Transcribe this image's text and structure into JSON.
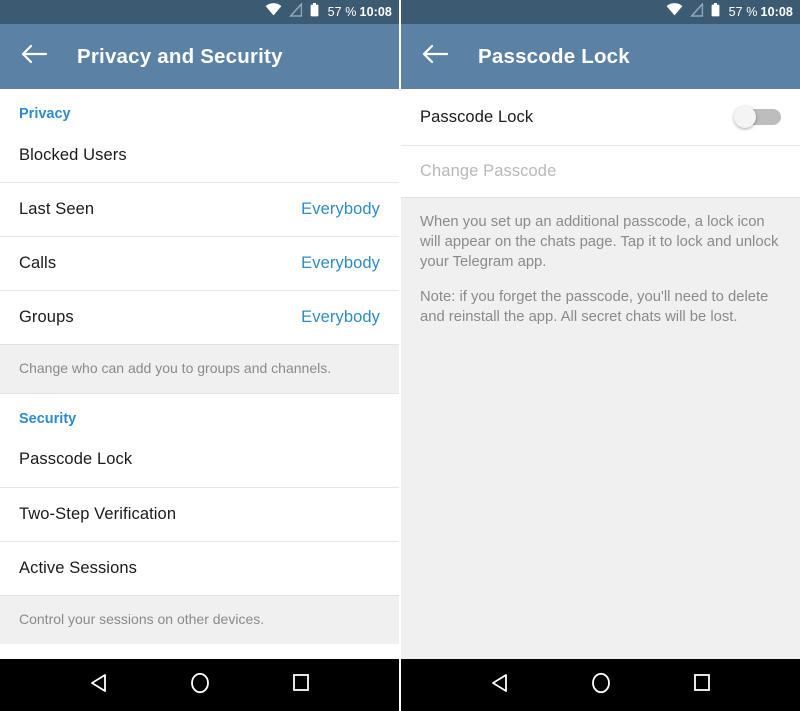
{
  "status_bar": {
    "icons": [
      "wifi-icon",
      "signal-off-icon",
      "battery-icon"
    ],
    "battery_percent": "57 %",
    "clock": "10:08"
  },
  "colors": {
    "status_bar_bg": "#3d5a73",
    "app_bar_bg": "#5b82a5",
    "accent": "#2e8bc9",
    "hint_bg": "#f0f0f0",
    "nav_bar_bg": "#000000"
  },
  "left_panel": {
    "app_bar": {
      "back_icon": "arrow-left-icon",
      "title": "Privacy and Security"
    },
    "sections": [
      {
        "header": "Privacy",
        "rows": [
          {
            "label": "Blocked Users",
            "value": ""
          },
          {
            "label": "Last Seen",
            "value": "Everybody"
          },
          {
            "label": "Calls",
            "value": "Everybody"
          },
          {
            "label": "Groups",
            "value": "Everybody"
          }
        ],
        "hint": "Change who can add you to groups and channels."
      },
      {
        "header": "Security",
        "rows": [
          {
            "label": "Passcode Lock",
            "value": ""
          },
          {
            "label": "Two-Step Verification",
            "value": ""
          },
          {
            "label": "Active Sessions",
            "value": ""
          }
        ],
        "hint": "Control your sessions on other devices."
      }
    ]
  },
  "right_panel": {
    "app_bar": {
      "back_icon": "arrow-left-icon",
      "title": "Passcode Lock"
    },
    "toggle_row": {
      "label": "Passcode Lock",
      "toggle_name": "passcode-lock-toggle",
      "toggle_state": "off"
    },
    "change_passcode_row": {
      "label": "Change Passcode",
      "enabled": "false"
    },
    "info": {
      "paragraph_1": "When you set up an additional passcode, a lock icon will appear on the chats page. Tap it to lock and unlock your Telegram app.",
      "paragraph_2": "Note: if you forget the passcode, you'll need to delete and reinstall the app. All secret chats will be lost."
    }
  },
  "nav_bar": {
    "buttons": [
      {
        "name": "back-nav-button",
        "icon": "triangle-back-icon"
      },
      {
        "name": "home-nav-button",
        "icon": "circle-home-icon"
      },
      {
        "name": "recents-nav-button",
        "icon": "square-recents-icon"
      }
    ]
  }
}
